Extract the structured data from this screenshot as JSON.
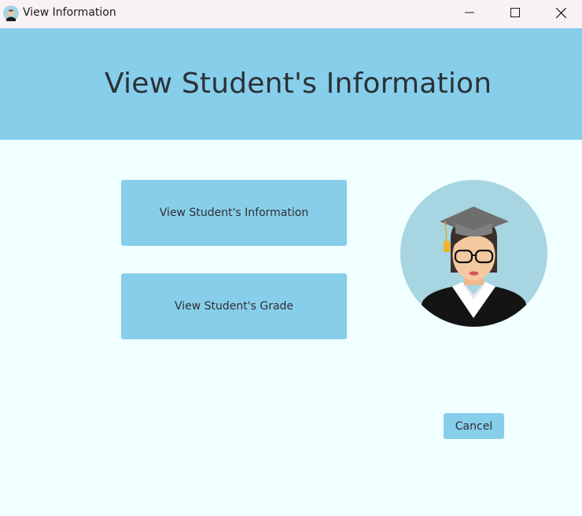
{
  "window": {
    "title": "View Information",
    "icon": "student-avatar-icon",
    "controls": [
      "minimize-icon",
      "maximize-icon",
      "close-icon"
    ]
  },
  "header": {
    "title": "View Student's Information"
  },
  "actions": {
    "view_info_label": "View Student's Information",
    "view_grade_label": "View Student's Grade"
  },
  "illustration": {
    "icon": "graduate-student-avatar"
  },
  "footer": {
    "cancel_label": "Cancel"
  },
  "colors": {
    "background": "#F0FFFF",
    "accent": "#87CEEB",
    "avatar_bg": "#A7D5E1",
    "titlebar": "#F8F2F4"
  }
}
